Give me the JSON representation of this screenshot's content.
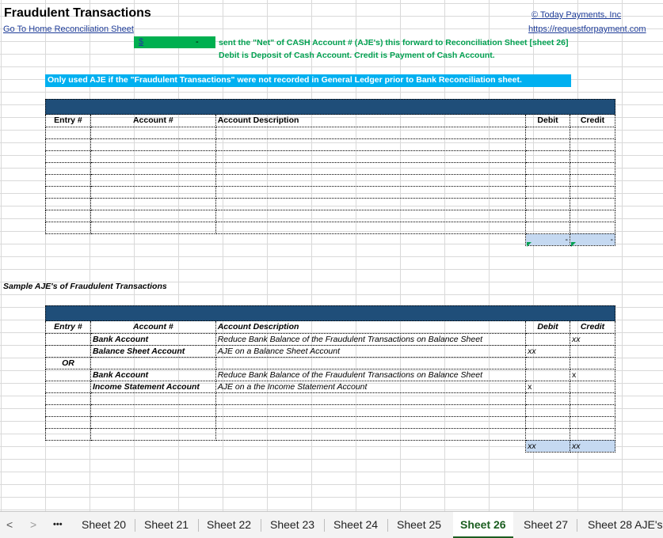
{
  "sheet": {
    "title": "Fraudulent Transactions",
    "home_link": "Go To Home Reconciliation Sheet",
    "company": "© Today Payments, Inc",
    "website": "https://requestforpayment.com",
    "net_cell_symbol": "$",
    "net_cell_value": "-",
    "instruction_line1": "sent the \"Net\" of CASH Account # (AJE's) this forward to Reconciliation Sheet [sheet 26]",
    "instruction_line2": "Debit is Deposit of Cash Account.  Credit is Payment of Cash Account.",
    "note": "Only used AJE if the \"Fraudulent Transactions\" were not recorded in General Ledger prior to Bank Reconciliation sheet.",
    "table1": {
      "headers": [
        "Entry #",
        "Account #",
        "Account Description",
        "Debit",
        "Credit"
      ],
      "total_debit": "-",
      "total_credit": "-"
    },
    "sample_title": "Sample AJE's of Fraudulent Transactions",
    "table2": {
      "headers": [
        "Entry #",
        "Account #",
        "Account Description",
        "Debit",
        "Credit"
      ],
      "rows": [
        {
          "entry": "",
          "account": "Bank Account",
          "desc": "Reduce Bank Balance of the Fraudulent Transactions on Balance Sheet",
          "debit": "",
          "credit": "xx"
        },
        {
          "entry": "",
          "account": "Balance Sheet Account",
          "desc": "AJE on a Balance Sheet Account",
          "debit": "xx",
          "credit": ""
        },
        {
          "entry": "OR",
          "account": "",
          "desc": "",
          "debit": "",
          "credit": ""
        },
        {
          "entry": "",
          "account": "Bank Account",
          "desc": "Reduce Bank Balance of the Fraudulent Transactions on Balance Sheet",
          "debit": "",
          "credit": "x"
        },
        {
          "entry": "",
          "account": "Income Statement Account",
          "desc": "AJE on a the Income Statement Account",
          "debit": "x",
          "credit": ""
        }
      ],
      "total_debit": "xx",
      "total_credit": "xx"
    }
  },
  "tabs": {
    "prev": "<",
    "next": ">",
    "more": "•••",
    "items": [
      "Sheet 20",
      "Sheet 21",
      "Sheet 22",
      "Sheet 23",
      "Sheet 24",
      "Sheet 25",
      "Sheet 26",
      "Sheet 27",
      "Sheet 28 AJE's"
    ],
    "active": "Sheet 26"
  },
  "colors": {
    "header_bar": "#1f4e79",
    "note_bar": "#00b0f0",
    "green": "#00b050",
    "total_fill": "#c5d9f1"
  }
}
